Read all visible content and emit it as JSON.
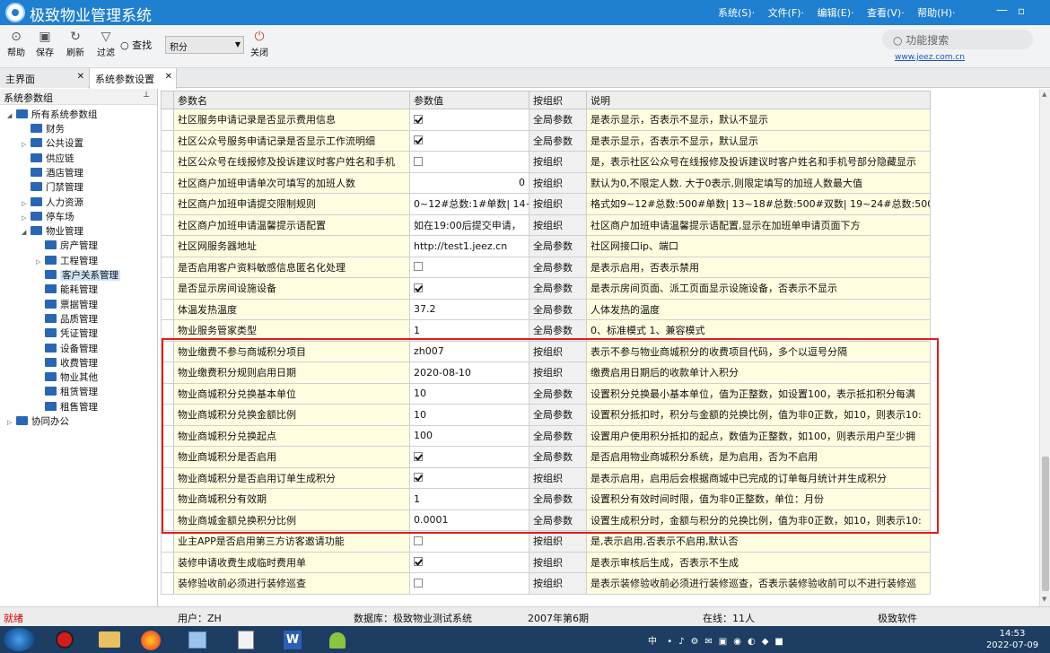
{
  "app": {
    "title": "极致物业管理系统",
    "menus": [
      "系统(S)·",
      "文件(F)·",
      "编辑(E)·",
      "查看(V)·",
      "帮助(H)·"
    ]
  },
  "toolbar": {
    "help": "帮助",
    "save": "保存",
    "refresh": "刷新",
    "filter": "过滤",
    "find": "查找",
    "combo": "积分",
    "close": "关闭",
    "func_search": "功能搜索",
    "website": "www.jeez.com.cn"
  },
  "tabs": [
    {
      "label": "主界面"
    },
    {
      "label": "系统参数设置"
    }
  ],
  "sidebar": {
    "header": "系统参数组",
    "root": "所有系统参数组",
    "items": [
      "财务",
      "公共设置",
      "供应链",
      "酒店管理",
      "门禁管理",
      "人力资源",
      "停车场",
      "物业管理",
      "房产管理",
      "工程管理",
      "客户关系管理",
      "能耗管理",
      "票据管理",
      "品质管理",
      "凭证管理",
      "设备管理",
      "收费管理",
      "物业其他",
      "租赁管理",
      "租售管理",
      "协同办公"
    ]
  },
  "grid": {
    "headers": [
      "参数名",
      "参数值",
      "按组织",
      "说明"
    ],
    "rows": [
      {
        "name": "社区服务申请记录是否显示费用信息",
        "value": "",
        "check": true,
        "scope": "全局参数",
        "desc": "是表示显示，否表示不显示，默认不显示"
      },
      {
        "name": "社区公众号服务申请记录是否显示工作流明细",
        "value": "",
        "check": true,
        "scope": "全局参数",
        "desc": "是表示显示，否表示不显示，默认显示"
      },
      {
        "name": "社区公众号在线报修及投诉建议时客户姓名和手机",
        "value": "",
        "check": false,
        "scope": "按组织",
        "desc": "是，表示社区公众号在线报修及投诉建议时客户姓名和手机号部分隐藏显示"
      },
      {
        "name": "社区商户加班申请单次可填写的加班人数",
        "value": "0",
        "check": null,
        "scope": "按组织",
        "desc": "默认为0,不限定人数. 大于0表示,则限定填写的加班人数最大值"
      },
      {
        "name": "社区商户加班申请提交限制规则",
        "value": "0~12#总数:1#单数| 14~",
        "check": null,
        "scope": "按组织",
        "desc": "格式如9~12#总数:500#单数| 13~18#总数:500#双数| 19~24#总数:500#"
      },
      {
        "name": "社区商户加班申请温馨提示语配置",
        "value": "如在19:00后提交申请，",
        "check": null,
        "scope": "按组织",
        "desc": "社区商户加班申请温馨提示语配置,显示在加班单申请页面下方"
      },
      {
        "name": "社区网服务器地址",
        "value": "http://test1.jeez.cn",
        "check": null,
        "scope": "全局参数",
        "desc": "社区网接口ip、端口"
      },
      {
        "name": "是否启用客户资料敏感信息匿名化处理",
        "value": "",
        "check": false,
        "scope": "全局参数",
        "desc": "是表示启用，否表示禁用"
      },
      {
        "name": "是否显示房间设施设备",
        "value": "",
        "check": true,
        "scope": "全局参数",
        "desc": "是表示房间页面、派工页面显示设施设备，否表示不显示"
      },
      {
        "name": "体温发热温度",
        "value": "37.2",
        "check": null,
        "scope": "全局参数",
        "desc": "人体发热的温度"
      },
      {
        "name": "物业服务管家类型",
        "value": "1",
        "check": null,
        "scope": "全局参数",
        "desc": "0、标准模式 1、兼容模式"
      },
      {
        "name": "物业缴费不参与商城积分项目",
        "value": "zh007",
        "check": null,
        "scope": "按组织",
        "desc": "表示不参与物业商城积分的收费项目代码，多个以逗号分隔"
      },
      {
        "name": "物业缴费积分规则启用日期",
        "value": "2020-08-10",
        "check": null,
        "scope": "按组织",
        "desc": "缴费启用日期后的收款单计入积分"
      },
      {
        "name": "物业商城积分兑换基本单位",
        "value": "10",
        "check": null,
        "scope": "全局参数",
        "desc": "设置积分兑换最小基本单位，值为正整数，如设置100，表示抵扣积分每满"
      },
      {
        "name": "物业商城积分兑换金额比例",
        "value": "10",
        "check": null,
        "scope": "全局参数",
        "desc": "设置积分抵扣时，积分与金额的兑换比例，值为非0正数，如10，则表示10:"
      },
      {
        "name": "物业商城积分兑换起点",
        "value": "100",
        "check": null,
        "scope": "全局参数",
        "desc": "设置用户使用积分抵扣的起点，数值为正整数，如100，则表示用户至少拥"
      },
      {
        "name": "物业商城积分是否启用",
        "value": "",
        "check": true,
        "scope": "全局参数",
        "desc": "是否启用物业商城积分系统，是为启用，否为不启用"
      },
      {
        "name": "物业商城积分是否启用订单生成积分",
        "value": "",
        "check": true,
        "scope": "按组织",
        "desc": "是表示启用，启用后会根据商城中已完成的订单每月统计并生成积分"
      },
      {
        "name": "物业商城积分有效期",
        "value": "1",
        "check": null,
        "scope": "全局参数",
        "desc": "设置积分有效时间时限，值为非0正整数，单位：月份"
      },
      {
        "name": "物业商城金额兑换积分比例",
        "value": "0.0001",
        "check": null,
        "scope": "全局参数",
        "desc": "设置生成积分时，金额与积分的兑换比例，值为非0正数，如10，则表示10:"
      },
      {
        "name": "业主APP是否启用第三方访客邀请功能",
        "value": "",
        "check": false,
        "scope": "按组织",
        "desc": "是,表示启用,否表示不启用,默认否"
      },
      {
        "name": "装修申请收费生成临时费用单",
        "value": "",
        "check": true,
        "scope": "按组织",
        "desc": "是表示审核后生成，否表示不生成"
      },
      {
        "name": "装修验收前必须进行装修巡查",
        "value": "",
        "check": false,
        "scope": "按组织",
        "desc": "是表示装修验收前必须进行装修巡查，否表示装修验收前可以不进行装修巡"
      }
    ]
  },
  "status": {
    "state": "就绪",
    "user": "用户：ZH",
    "db": "数据库：极致物业测试系统",
    "period": "2007年第6期",
    "online": "在线：11人",
    "brand": "极致软件"
  },
  "taskbar": {
    "time": "14:53",
    "date": "2022-07-09",
    "ime": "中"
  }
}
